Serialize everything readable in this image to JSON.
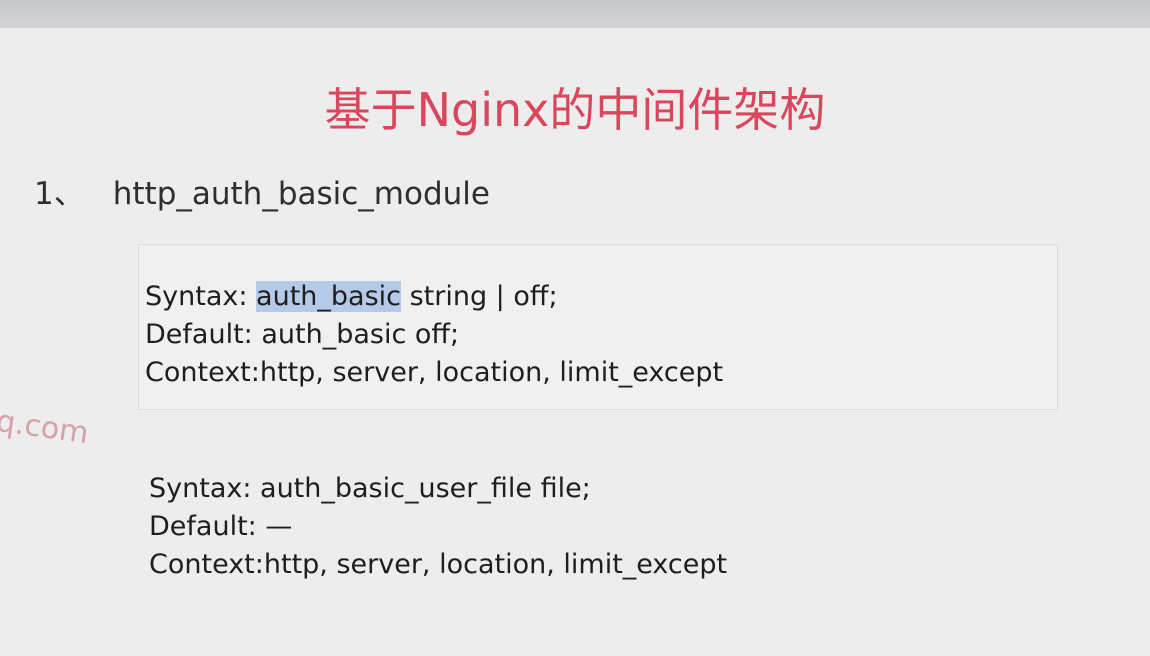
{
  "slide": {
    "title": "基于Nginx的中间件架构",
    "heading_number": "1、",
    "heading_text": "http_auth_basic_module",
    "watermark": "q.com"
  },
  "block1": {
    "syntax_label": "Syntax: ",
    "syntax_directive": "auth_basic",
    "syntax_rest": " string | off;",
    "default_line": "Default: auth_basic off;",
    "context_line": "Context:http, server, location, limit_except"
  },
  "block2": {
    "syntax_line": "Syntax:  auth_basic_user_file file;",
    "default_line": "Default: —",
    "context_line": "Context:http, server, location, limit_except"
  },
  "colors": {
    "title": "#d8475c",
    "highlight": "#b5cae8"
  }
}
